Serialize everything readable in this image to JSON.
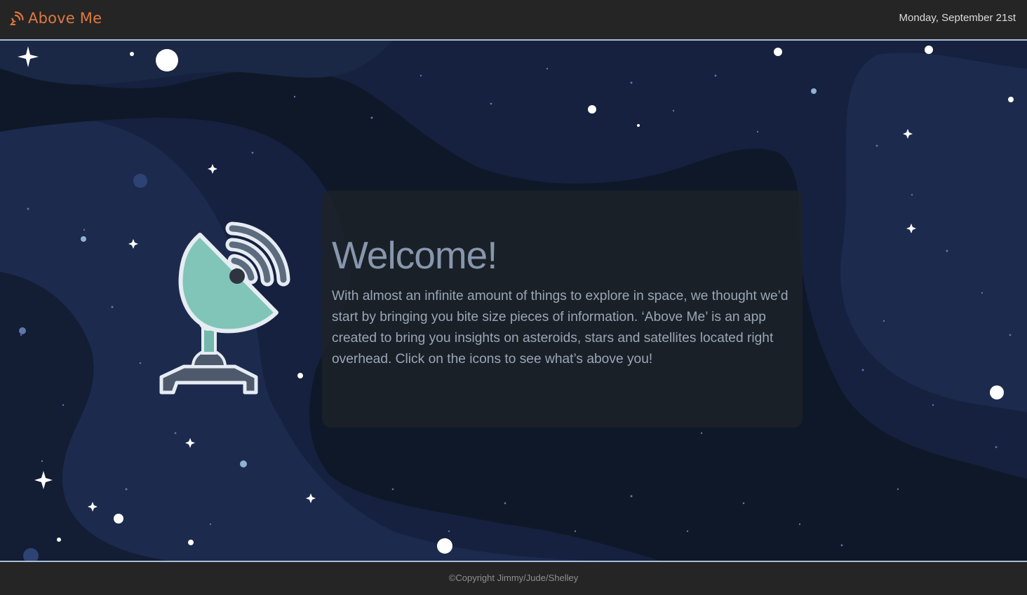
{
  "header": {
    "brand_name": "Above Me",
    "brand_icon": "satellite-signal-icon",
    "date": "Monday, September 21st",
    "accent_color": "#e0783f"
  },
  "hero": {
    "title": "Welcome!",
    "body": "With almost an infinite amount of things to explore in space, we thought we’d start by bringing you bite size pieces of information. ‘Above Me’ is an app created to bring you insights on asteroids, stars and satellites located right overhead. Click on the icons to see what’s above you!",
    "icon": "satellite-dish-icon",
    "dish_color": "#80c5b8"
  },
  "footer": {
    "copyright": "©Copyright Jimmy/Jude/Shelley"
  }
}
